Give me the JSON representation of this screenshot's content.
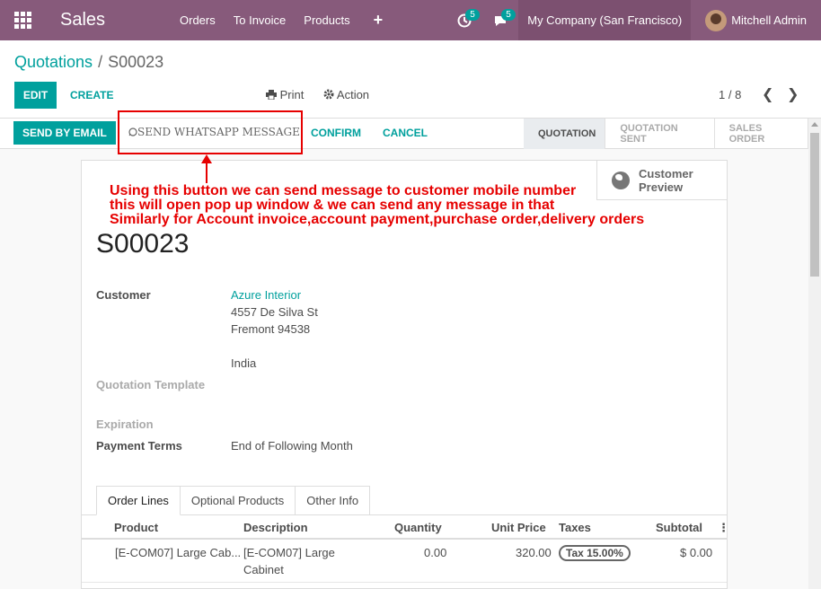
{
  "navbar": {
    "app_name": "Sales",
    "menu": [
      "Orders",
      "To Invoice",
      "Products"
    ],
    "plus": "+",
    "activity_badge": "5",
    "messages_badge": "5",
    "company": "My Company (San Francisco)",
    "user": "Mitchell Admin"
  },
  "breadcrumb": {
    "parent": "Quotations",
    "separator": "/",
    "current": "S00023"
  },
  "toolbar": {
    "edit": "EDIT",
    "create": "CREATE",
    "print": "Print",
    "action": "Action",
    "pager": "1 / 8"
  },
  "statusbar": {
    "send_email": "SEND BY EMAIL",
    "send_whatsapp": "SEND WHATSAPP MESSAGE",
    "confirm": "CONFIRM",
    "cancel": "CANCEL",
    "stages": [
      "QUOTATION",
      "QUOTATION SENT",
      "SALES ORDER"
    ],
    "active_stage": "QUOTATION"
  },
  "annotation": {
    "line1": "Using this button we can send message to customer mobile number",
    "line2": "this will open pop up window & we can send any message in that",
    "line3": "Similarly for Account invoice,account payment,purchase order,delivery orders"
  },
  "sheet": {
    "customer_preview": "Customer Preview",
    "title": "S00023",
    "customer_label": "Customer",
    "customer_name": "Azure Interior",
    "address_street": "4557 De Silva St",
    "address_city": "Fremont 94538",
    "address_country": "India",
    "quotation_template_label": "Quotation Template",
    "expiration_label": "Expiration",
    "payment_terms_label": "Payment Terms",
    "payment_terms_value": "End of Following Month"
  },
  "tabs": [
    "Order Lines",
    "Optional Products",
    "Other Info"
  ],
  "order_lines": {
    "columns": [
      "Product",
      "Description",
      "Quantity",
      "Unit Price",
      "Taxes",
      "Subtotal"
    ],
    "rows": [
      {
        "product": "[E-COM07] Large Cab...",
        "description_1": "[E-COM07] Large",
        "description_2": "Cabinet",
        "quantity": "0.00",
        "unit_price": "320.00",
        "tax": "Tax 15.00%",
        "subtotal": "$ 0.00"
      }
    ]
  }
}
